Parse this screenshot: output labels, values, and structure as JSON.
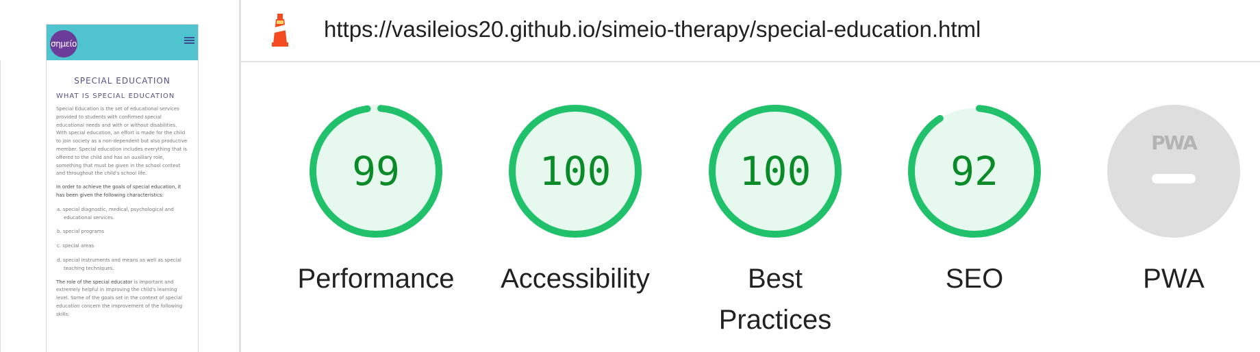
{
  "report": {
    "url": "https://vasileios20.github.io/simeio-therapy/special-education.html"
  },
  "categories": [
    {
      "label": "Performance",
      "score": "99",
      "value": 0.99
    },
    {
      "label": "Accessibility",
      "score": "100",
      "value": 1.0
    },
    {
      "label": "Best Practices",
      "label_line1": "Best",
      "label_line2": "Practices",
      "score": "100",
      "value": 1.0
    },
    {
      "label": "SEO",
      "score": "92",
      "value": 0.92
    },
    {
      "label": "PWA",
      "badge": "PWA"
    }
  ],
  "colors": {
    "pass": "#21c16b",
    "pass_fill": "#e7f8ee",
    "pass_text": "#0b8a2a",
    "pwa_gray": "#dedede",
    "pwa_badge": "#b4b4b4",
    "header_teal": "#4fc4cf",
    "logo_purple": "#6c3c9a"
  },
  "preview": {
    "logo_text": "σημείο",
    "title": "SPECIAL EDUCATION",
    "subtitle": "WHAT IS SPECIAL EDUCATION",
    "para1": "Special Education is the set of educational services provided to students with confirmed special educational needs and with or without disabilities. With special education, an effort is made for the child to join society as a non-dependent but also productive member. Special education includes everything that is offered to the child and has an auxiliary role, something that must be given in the school context and throughout the child's school life.",
    "para2": "In order to achieve the goals of special education, it has been given the following characteristics:",
    "list": [
      "a. special diagnostic, medical, psychological and educational services.",
      "b. special programs",
      "c. special areas",
      "d. special instruments and means as well as special teaching techniques."
    ],
    "para3_bold": "The role of the special educator",
    "para3_rest": " is important and extremely helpful in improving the child's learning level. Some of the goals set in the context of special education concern the improvement of the following skills:"
  }
}
